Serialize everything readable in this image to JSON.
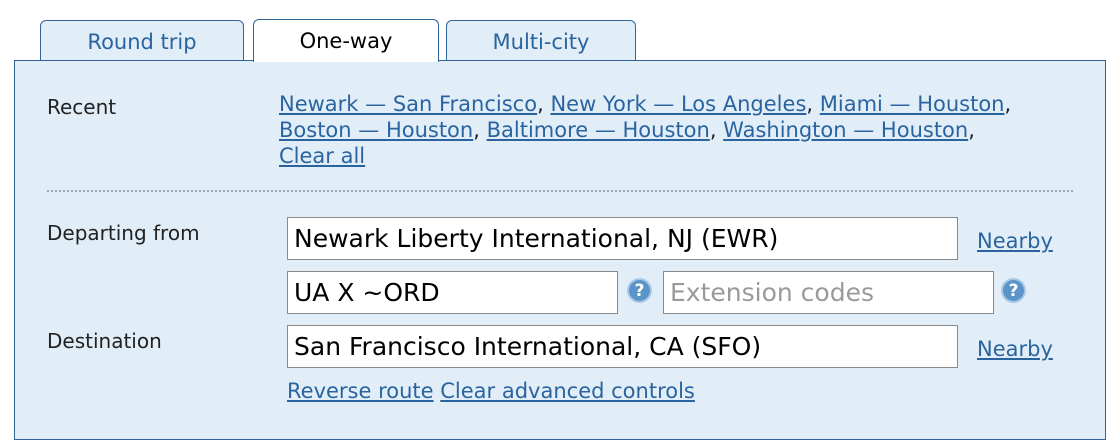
{
  "tabs": [
    {
      "label": "Round trip",
      "active": false
    },
    {
      "label": "One-way",
      "active": true
    },
    {
      "label": "Multi-city",
      "active": false
    }
  ],
  "recent": {
    "label": "Recent",
    "items": [
      "Newark — San Francisco",
      "New York — Los Angeles",
      "Miami — Houston",
      "Boston — Houston",
      "Baltimore — Houston",
      "Washington — Houston"
    ],
    "clear_all": "Clear all"
  },
  "departing": {
    "label": "Departing from",
    "value": "Newark Liberty International, NJ (EWR)",
    "nearby": "Nearby"
  },
  "advanced": {
    "routing_value": "UA X ~ORD",
    "extension_placeholder": "Extension codes",
    "help_icon": "?"
  },
  "destination": {
    "label": "Destination",
    "value": "San Francisco International, CA (SFO)",
    "nearby": "Nearby"
  },
  "actions": {
    "reverse_route": "Reverse route",
    "clear_advanced": "Clear advanced controls"
  },
  "colors": {
    "panel_bg": "#e2eef7",
    "border": "#2f6497",
    "link": "#2a64a0"
  }
}
